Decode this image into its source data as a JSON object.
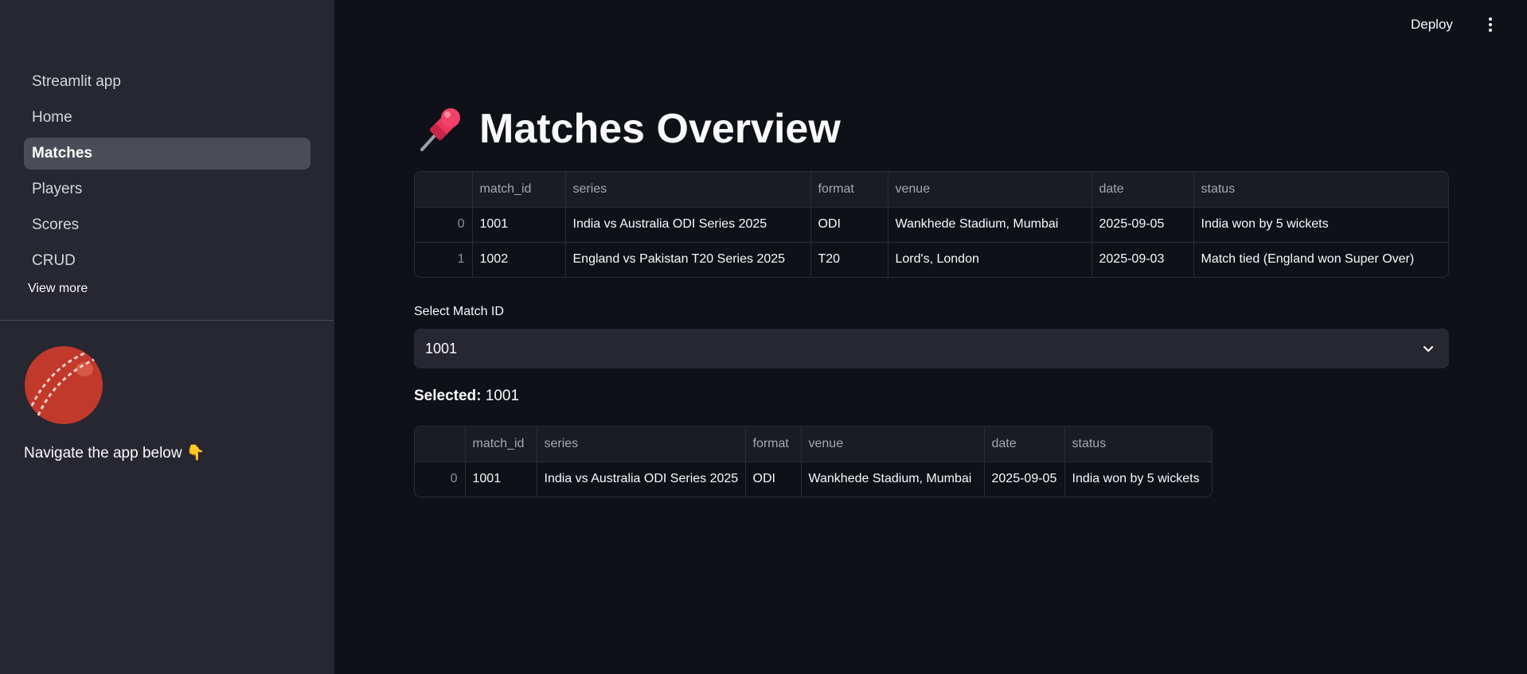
{
  "header": {
    "deploy_label": "Deploy"
  },
  "sidebar": {
    "items": [
      {
        "label": "Streamlit app"
      },
      {
        "label": "Home"
      },
      {
        "label": "Matches",
        "active": true
      },
      {
        "label": "Players"
      },
      {
        "label": "Scores"
      },
      {
        "label": "CRUD"
      }
    ],
    "view_more": "View more",
    "logo_icon": "cricket-ball-icon",
    "caption": "Navigate the app below 👇"
  },
  "main": {
    "title": "Matches Overview",
    "title_icon": "pushpin-icon",
    "matches_table": {
      "columns": [
        "",
        "match_id",
        "series",
        "format",
        "venue",
        "date",
        "status"
      ],
      "rows": [
        [
          "0",
          "1001",
          "India vs Australia ODI Series 2025",
          "ODI",
          "Wankhede Stadium, Mumbai",
          "2025-09-05",
          "India won by 5 wickets"
        ],
        [
          "1",
          "1002",
          "England vs Pakistan T20 Series 2025",
          "T20",
          "Lord's, London",
          "2025-09-03",
          "Match tied (England won Super Over)"
        ]
      ]
    },
    "select": {
      "label": "Select Match ID",
      "value": "1001"
    },
    "selected": {
      "label": "Selected:",
      "value": "1001"
    },
    "selected_table": {
      "columns": [
        "",
        "match_id",
        "series",
        "format",
        "venue",
        "date",
        "status"
      ],
      "rows": [
        [
          "0",
          "1001",
          "India vs Australia ODI Series 2025",
          "ODI",
          "Wankhede Stadium, Mumbai",
          "2025-09-05",
          "India won by 5 wickets"
        ]
      ]
    }
  },
  "colors": {
    "background": "#0e1117",
    "sidebar": "#262730",
    "active_nav": "#4a4c58",
    "cricket_ball": "#c0392b"
  }
}
